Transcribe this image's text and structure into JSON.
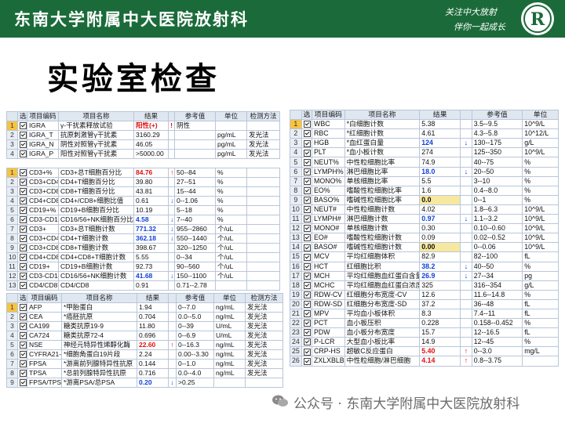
{
  "banner": {
    "title": "东南大学附属中大医院放射科",
    "slogan_line1": "关注中大放射",
    "slogan_line2": "伴你一起成长",
    "logo_text": "R"
  },
  "heading": "实验室检查",
  "top_left": {
    "headers": [
      "选",
      "项目编码",
      "项目名称",
      "结果",
      "参考值",
      "单位",
      "检测方法"
    ],
    "rows": [
      {
        "num": "1",
        "code": "IGRA",
        "name": "γ-干扰素释放试验",
        "result": "阳性(+)",
        "flag": "!",
        "ref": "阴性",
        "unit": "",
        "method": "",
        "r": "red",
        "sel": true
      },
      {
        "num": "2",
        "code": "IGRA_T",
        "name": "抗原刺激管γ干扰素",
        "result": "3160.29",
        "flag": "",
        "ref": "",
        "unit": "pg/mL",
        "method": "发光法",
        "r": "",
        "sel": false
      },
      {
        "num": "3",
        "code": "IGRA_N",
        "name": "阴性对照管γ干扰素",
        "result": "46.05",
        "flag": "",
        "ref": "",
        "unit": "pg/mL",
        "method": "发光法",
        "r": "",
        "sel": false
      },
      {
        "num": "4",
        "code": "IGRA_P",
        "name": "阳性对照管γ干扰素",
        "result": ">5000.00",
        "flag": "",
        "ref": "",
        "unit": "pg/mL",
        "method": "发光法",
        "r": "",
        "sel": false
      }
    ]
  },
  "mid_left": {
    "rows": [
      {
        "num": "1",
        "code": "CD3+%",
        "name": "CD3+总T细胞百分比",
        "result": "84.76",
        "flag": "↑",
        "ref": "50--84",
        "unit": "%",
        "r": "red",
        "sel": true
      },
      {
        "num": "2",
        "code": "CD3+CD4+",
        "name": "CD4+T细胞百分比",
        "result": "39.80",
        "flag": "",
        "ref": "27--51",
        "unit": "%",
        "r": "",
        "sel": false
      },
      {
        "num": "3",
        "code": "CD3+CD8+",
        "name": "CD8+T细胞百分比",
        "result": "43.81",
        "flag": "",
        "ref": "15--44",
        "unit": "%",
        "r": "",
        "sel": false
      },
      {
        "num": "4",
        "code": "CD4+CD8+",
        "name": "CD4+/CD8+细胞比值",
        "result": "0.61",
        "flag": "↓",
        "ref": "0--1.06",
        "unit": "%",
        "r": "",
        "sel": false
      },
      {
        "num": "5",
        "code": "CD19+%",
        "name": "CD19+B细胞百分比",
        "result": "10.19",
        "flag": "",
        "ref": "5--18",
        "unit": "%",
        "r": "",
        "sel": false
      },
      {
        "num": "6",
        "code": "CD3-CD16",
        "name": "CD16/56+NK细胞百分比",
        "result": "4.58",
        "flag": "↓",
        "ref": "7--40",
        "unit": "%",
        "r": "blue",
        "sel": false
      },
      {
        "num": "7",
        "code": "CD3+",
        "name": "CD3+总T细胞计数",
        "result": "771.32",
        "flag": "↓",
        "ref": "955--2860",
        "unit": "个/uL",
        "r": "blue",
        "sel": false
      },
      {
        "num": "8",
        "code": "CD3+CD4+",
        "name": "CD4+T细胞计数",
        "result": "362.18",
        "flag": "↓",
        "ref": "550--1440",
        "unit": "个/uL",
        "r": "blue",
        "sel": false
      },
      {
        "num": "9",
        "code": "CD3+CD8+",
        "name": "CD8+T细胞计数",
        "result": "398.67",
        "flag": "",
        "ref": "320--1250",
        "unit": "个/uL",
        "r": "",
        "sel": false
      },
      {
        "num": "10",
        "code": "CD4+CD8+",
        "name": "CD4+CD8+T细胞计数",
        "result": "5.55",
        "flag": "",
        "ref": "0--34",
        "unit": "个/uL",
        "r": "",
        "sel": false
      },
      {
        "num": "11",
        "code": "CD19+",
        "name": "CD19+B细胞计数",
        "result": "92.73",
        "flag": "",
        "ref": "90--560",
        "unit": "个/uL",
        "r": "",
        "sel": false
      },
      {
        "num": "12",
        "code": "CD3-CD16",
        "name": "CD16/56+NK细胞计数",
        "result": "41.68",
        "flag": "↓",
        "ref": "150--1100",
        "unit": "个/uL",
        "r": "blue",
        "sel": false
      },
      {
        "num": "13",
        "code": "CD4/CD8",
        "name": "CD4/CD8",
        "result": "0.91",
        "flag": "",
        "ref": "0.71--2.78",
        "unit": "",
        "r": "",
        "sel": false
      }
    ]
  },
  "bottom_left": {
    "headers": [
      "选",
      "项目编码",
      "项目名称",
      "结果",
      "",
      "参考值",
      "单位",
      "检测方法"
    ],
    "rows": [
      {
        "num": "1",
        "code": "AFP",
        "name": "*甲胎蛋白",
        "result": "1.94",
        "flag": "",
        "ref": "0--7.0",
        "unit": "ng/mL",
        "method": "发光法",
        "r": "",
        "sel": true
      },
      {
        "num": "2",
        "code": "CEA",
        "name": "*癌胚抗原",
        "result": "0.704",
        "flag": "",
        "ref": "0.0--5.0",
        "unit": "ng/mL",
        "method": "发光法",
        "r": "",
        "sel": false
      },
      {
        "num": "3",
        "code": "CA199",
        "name": "糖类抗原19-9",
        "result": "11.80",
        "flag": "",
        "ref": "0--39",
        "unit": "U/mL",
        "method": "发光法",
        "r": "",
        "sel": false
      },
      {
        "num": "4",
        "code": "CA724",
        "name": "糖类抗原72-4",
        "result": "0.696",
        "flag": "",
        "ref": "0--6.9",
        "unit": "U/mL",
        "method": "发光法",
        "r": "",
        "sel": false
      },
      {
        "num": "5",
        "code": "NSE",
        "name": "神经元特异性烯醇化酶",
        "result": "22.60",
        "flag": "↑",
        "ref": "0--16.3",
        "unit": "ng/mL",
        "method": "发光法",
        "r": "red",
        "sel": false
      },
      {
        "num": "6",
        "code": "CYFRA21-1",
        "name": "*细胞角蛋白19片段",
        "result": "2.24",
        "flag": "",
        "ref": "0.00--3.30",
        "unit": "ng/mL",
        "method": "发光法",
        "r": "",
        "sel": false
      },
      {
        "num": "7",
        "code": "FPSA",
        "name": "*游离前列腺特异性抗原",
        "result": "0.144",
        "flag": "",
        "ref": "0--1.0",
        "unit": "ng/mL",
        "method": "发光法",
        "r": "",
        "sel": false
      },
      {
        "num": "8",
        "code": "TPSA",
        "name": "*总前列腺特异性抗原",
        "result": "0.716",
        "flag": "",
        "ref": "0.0--4.0",
        "unit": "ng/mL",
        "method": "发光法",
        "r": "",
        "sel": false
      },
      {
        "num": "9",
        "code": "FPSA/TPSA",
        "name": "*游离PSA/总PSA",
        "result": "0.20",
        "flag": "↓",
        "ref": ">0.25",
        "unit": "",
        "method": "",
        "r": "blue",
        "sel": false
      }
    ]
  },
  "right": {
    "headers": [
      "选",
      "项目编码",
      "项目名称",
      "结果",
      "",
      "参考值",
      "单位"
    ],
    "rows": [
      {
        "num": "1",
        "code": "WBC",
        "name": "*白细胞计数",
        "result": "5.38",
        "flag": "",
        "ref": "3.5--9.5",
        "unit": "10^9/L",
        "r": "",
        "sel": true
      },
      {
        "num": "2",
        "code": "RBC",
        "name": "*红细胞计数",
        "result": "4.61",
        "flag": "",
        "ref": "4.3--5.8",
        "unit": "10^12/L",
        "r": "",
        "sel": false
      },
      {
        "num": "3",
        "code": "HGB",
        "name": "*血红蛋白量",
        "result": "124",
        "flag": "↓",
        "ref": "130--175",
        "unit": "g/L",
        "r": "blue",
        "sel": false
      },
      {
        "num": "4",
        "code": "PLT",
        "name": "*血小板计数",
        "result": "274",
        "flag": "",
        "ref": "125--350",
        "unit": "10^9/L",
        "r": "",
        "sel": false
      },
      {
        "num": "5",
        "code": "NEUT%",
        "name": "中性粒细胞比率",
        "result": "74.9",
        "flag": "",
        "ref": "40--75",
        "unit": "%",
        "r": "",
        "sel": false
      },
      {
        "num": "6",
        "code": "LYMPH%",
        "name": "淋巴细胞比率",
        "result": "18.0",
        "flag": "↓",
        "ref": "20--50",
        "unit": "%",
        "r": "blue",
        "sel": false
      },
      {
        "num": "7",
        "code": "MONO%",
        "name": "单核细胞比率",
        "result": "5.5",
        "flag": "",
        "ref": "3--10",
        "unit": "%",
        "r": "",
        "sel": false
      },
      {
        "num": "8",
        "code": "EO%",
        "name": "嗜酸性粒细胞比率",
        "result": "1.6",
        "flag": "",
        "ref": "0.4--8.0",
        "unit": "%",
        "r": "",
        "sel": false
      },
      {
        "num": "9",
        "code": "BASO%",
        "name": "嗜碱性粒细胞比率",
        "result": "0.0",
        "flag": "",
        "ref": "0--1",
        "unit": "%",
        "r": "yel",
        "sel": false
      },
      {
        "num": "10",
        "code": "NEUT#",
        "name": "中性粒细胞计数",
        "result": "4.02",
        "flag": "",
        "ref": "1.8--6.3",
        "unit": "10^9/L",
        "r": "",
        "sel": false
      },
      {
        "num": "11",
        "code": "LYMPH#",
        "name": "淋巴细胞计数",
        "result": "0.97",
        "flag": "↓",
        "ref": "1.1--3.2",
        "unit": "10^9/L",
        "r": "blue",
        "sel": false
      },
      {
        "num": "12",
        "code": "MONO#",
        "name": "单核细胞计数",
        "result": "0.30",
        "flag": "",
        "ref": "0.10--0.60",
        "unit": "10^9/L",
        "r": "",
        "sel": false
      },
      {
        "num": "13",
        "code": "EO#",
        "name": "嗜酸性粒细胞计数",
        "result": "0.09",
        "flag": "",
        "ref": "0.02--0.52",
        "unit": "10^9/L",
        "r": "",
        "sel": false
      },
      {
        "num": "14",
        "code": "BASO#",
        "name": "嗜碱性粒细胞计数",
        "result": "0.00",
        "flag": "",
        "ref": "0--0.06",
        "unit": "10^9/L",
        "r": "yel",
        "sel": false
      },
      {
        "num": "15",
        "code": "MCV",
        "name": "平均红细胞体积",
        "result": "82.9",
        "flag": "",
        "ref": "82--100",
        "unit": "fL",
        "r": "",
        "sel": false
      },
      {
        "num": "16",
        "code": "HCT",
        "name": "红细胞比积",
        "result": "38.2",
        "flag": "↓",
        "ref": "40--50",
        "unit": "%",
        "r": "blue",
        "sel": false
      },
      {
        "num": "17",
        "code": "MCH",
        "name": "平均红细胞血红蛋白含量",
        "result": "26.9",
        "flag": "↓",
        "ref": "27--34",
        "unit": "pg",
        "r": "blue",
        "sel": false
      },
      {
        "num": "18",
        "code": "MCHC",
        "name": "平均红细胞血红蛋白浓度",
        "result": "325",
        "flag": "",
        "ref": "316--354",
        "unit": "g/L",
        "r": "",
        "sel": false
      },
      {
        "num": "19",
        "code": "RDW-CV",
        "name": "红细胞分布宽度-CV",
        "result": "12.6",
        "flag": "",
        "ref": "11.6--14.8",
        "unit": "%",
        "r": "",
        "sel": false
      },
      {
        "num": "20",
        "code": "RDW-SD",
        "name": "红细胞分布宽度-SD",
        "result": "37.2",
        "flag": "",
        "ref": "36--48",
        "unit": "fL",
        "r": "",
        "sel": false
      },
      {
        "num": "21",
        "code": "MPV",
        "name": "平均血小板体积",
        "result": "8.3",
        "flag": "",
        "ref": "7.4--11",
        "unit": "fL",
        "r": "",
        "sel": false
      },
      {
        "num": "22",
        "code": "PCT",
        "name": "血小板压积",
        "result": "0.228",
        "flag": "",
        "ref": "0.158--0.452",
        "unit": "%",
        "r": "",
        "sel": false
      },
      {
        "num": "23",
        "code": "PDW",
        "name": "血小板分布宽度",
        "result": "15.7",
        "flag": "",
        "ref": "12--16.5",
        "unit": "fL",
        "r": "",
        "sel": false
      },
      {
        "num": "24",
        "code": "P-LCR",
        "name": "大型血小板比率",
        "result": "14.9",
        "flag": "",
        "ref": "12--45",
        "unit": "%",
        "r": "",
        "sel": false
      },
      {
        "num": "25",
        "code": "CRP-HS",
        "name": "超敏C反应蛋白",
        "result": "5.40",
        "flag": "↑",
        "ref": "0--3.0",
        "unit": "mg/L",
        "r": "red",
        "sel": false
      },
      {
        "num": "26",
        "code": "ZXLXBLBX",
        "name": "中性粒细胞/淋巴细胞",
        "result": "4.14",
        "flag": "↑",
        "ref": "0.8--3.75",
        "unit": "",
        "r": "red",
        "sel": false
      }
    ]
  },
  "watermark": "公众号 · 东南大学附属中大医院放射科",
  "colors": {
    "banner": "#1b6b3a",
    "high": "#e01010",
    "low": "#1040d8",
    "highlight": "#f7e8a0"
  }
}
